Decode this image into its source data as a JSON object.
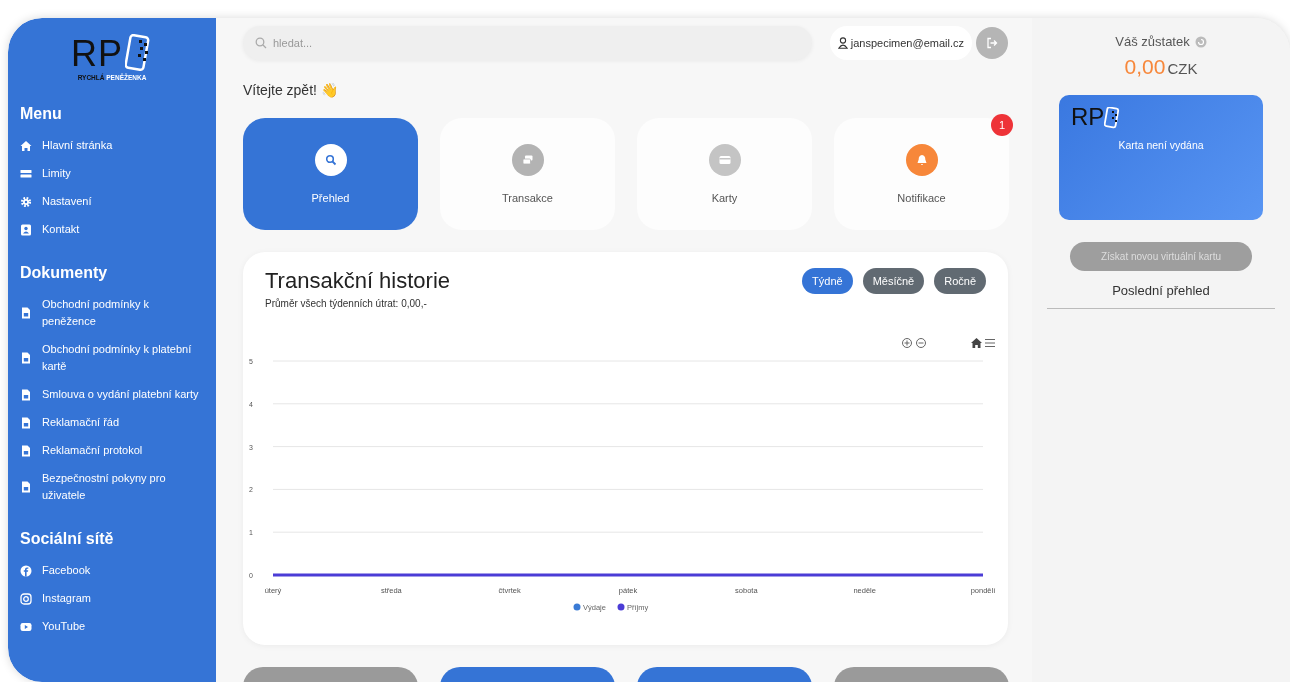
{
  "sidebar": {
    "logo": {
      "mark": "RP",
      "tagline_first": "RYCHLÁ",
      "tagline_second": "PENĚŽENKA"
    },
    "sections": [
      {
        "title": "Menu",
        "items": [
          {
            "label": "Hlavní stránka",
            "kind": "home"
          },
          {
            "label": "Limity",
            "kind": "limits"
          },
          {
            "label": "Nastavení",
            "kind": "gear"
          },
          {
            "label": "Kontakt",
            "kind": "contact"
          }
        ]
      },
      {
        "title": "Dokumenty",
        "items": [
          {
            "label": "Obchodní podmínky k peněžence",
            "kind": "document"
          },
          {
            "label": "Obchodní podmínky k platební kartě",
            "kind": "document"
          },
          {
            "label": "Smlouva o vydání platební karty",
            "kind": "document"
          },
          {
            "label": "Reklamační řád",
            "kind": "document"
          },
          {
            "label": "Reklamační protokol",
            "kind": "document"
          },
          {
            "label": "Bezpečnostní pokyny pro uživatele",
            "kind": "document"
          }
        ]
      },
      {
        "title": "Sociální sítě",
        "items": [
          {
            "label": "Facebook",
            "kind": "facebook"
          },
          {
            "label": "Instagram",
            "kind": "instagram"
          },
          {
            "label": "YouTube",
            "kind": "youtube"
          }
        ]
      }
    ]
  },
  "search": {
    "placeholder": "hledat..."
  },
  "user": {
    "email": "janspecimen@email.cz"
  },
  "welcome": "Vítejte zpět! 👋",
  "tiles": [
    {
      "label": "Přehled",
      "kind": "search",
      "selected": true,
      "color": "#ffffff"
    },
    {
      "label": "Transakce",
      "kind": "transactions",
      "selected": false,
      "color": "#b3b3b3"
    },
    {
      "label": "Karty",
      "kind": "card",
      "selected": false,
      "color": "#c4c4c4"
    },
    {
      "label": "Notifikace",
      "kind": "bell",
      "selected": false,
      "color": "#f7873a",
      "badge": "1"
    }
  ],
  "history": {
    "title": "Transakční historie",
    "subtitle": "Průměr všech týdenních útrat: 0,00,-",
    "periods": [
      {
        "label": "Týdně",
        "selected": true
      },
      {
        "label": "Měsíčně",
        "selected": false
      },
      {
        "label": "Ročně",
        "selected": false
      }
    ],
    "chart_data": {
      "type": "line",
      "categories": [
        "úterý",
        "středa",
        "čtvrtek",
        "pátek",
        "sobota",
        "neděle",
        "pondělí"
      ],
      "ylim": [
        0,
        5
      ],
      "yticks": [
        0,
        1,
        2,
        3,
        4,
        5
      ],
      "grid": true,
      "legend": true,
      "series": [
        {
          "name": "Výdaje",
          "color": "#3a7bd5",
          "values": [
            null,
            null,
            null,
            null,
            null,
            null,
            null
          ]
        },
        {
          "name": "Příjmy",
          "color": "#4b3cd6",
          "values": [
            0,
            0,
            0,
            0,
            0,
            0,
            0
          ]
        }
      ]
    }
  },
  "bottom_tiles": [
    {
      "color": "#9a9a9a"
    },
    {
      "color": "#3574d6"
    },
    {
      "color": "#3574d6"
    },
    {
      "color": "#9a9a9a"
    }
  ],
  "balance": {
    "label": "Váš zůstatek",
    "amount": "0,00",
    "currency": "CZK"
  },
  "virtual_card": {
    "mark": "RP",
    "status": "Karta není vydána"
  },
  "new_card_button": {
    "label": "Získat novou virtuální kartu",
    "disabled": true
  },
  "last_overview": {
    "title": "Poslední přehled"
  }
}
